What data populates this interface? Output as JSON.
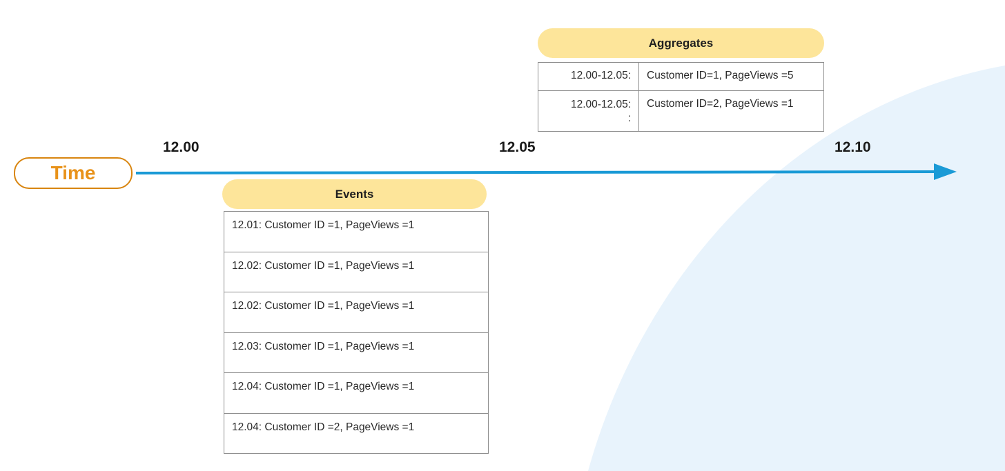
{
  "time_label": "Time",
  "ticks": [
    "12.00",
    "12.05",
    "12.10"
  ],
  "aggregates": {
    "title": "Aggregates",
    "rows": [
      {
        "range": "12.00-12.05:",
        "value": "Customer ID=1, PageViews =5"
      },
      {
        "range": "12.00-12.05:\n:",
        "value": "Customer ID=2, PageViews =1"
      }
    ]
  },
  "events": {
    "title": "Events",
    "rows": [
      "12.01: Customer ID =1, PageViews =1",
      "12.02: Customer ID =1, PageViews =1",
      "12.02: Customer ID =1, PageViews =1",
      "12.03: Customer ID =1, PageViews =1",
      "12.04: Customer ID =1, PageViews =1",
      "12.04: Customer ID =2, PageViews =1"
    ]
  },
  "colors": {
    "timeline": "#1a9ad6",
    "time_pill": "#e8921a",
    "header_fill": "#fde59a",
    "background_shape": "#e8f3fc"
  }
}
